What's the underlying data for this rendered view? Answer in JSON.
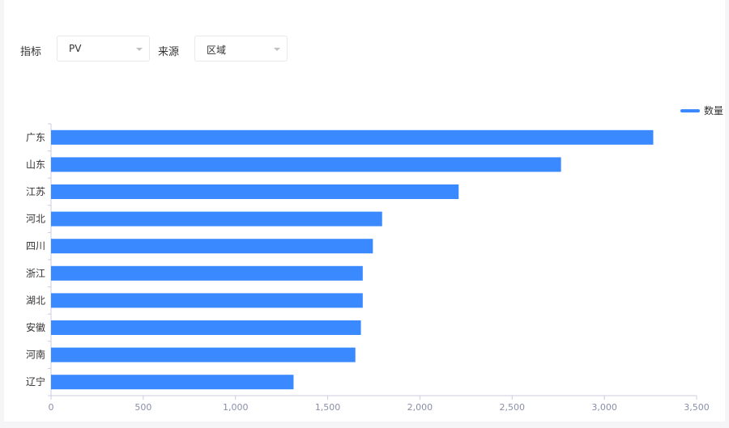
{
  "filters": {
    "metric_label": "指标",
    "metric_value": "PV",
    "source_label": "来源",
    "source_value": "区域"
  },
  "chart_data": {
    "type": "bar",
    "orientation": "horizontal",
    "categories": [
      "广东",
      "山东",
      "江苏",
      "河北",
      "四川",
      "浙江",
      "湖北",
      "安徽",
      "河南",
      "辽宁"
    ],
    "series": [
      {
        "name": "数量",
        "values": [
          3265,
          2765,
          2210,
          1795,
          1745,
          1690,
          1690,
          1680,
          1650,
          1315
        ],
        "color": "#3a89ff"
      }
    ],
    "xlim": [
      0,
      3500
    ],
    "xticks": [
      "0",
      "500",
      "1,000",
      "1,500",
      "2,000",
      "2,500",
      "3,000",
      "3,500"
    ],
    "xtick_values": [
      0,
      500,
      1000,
      1500,
      2000,
      2500,
      3000,
      3500
    ],
    "grid": false,
    "legend": "top-right"
  }
}
